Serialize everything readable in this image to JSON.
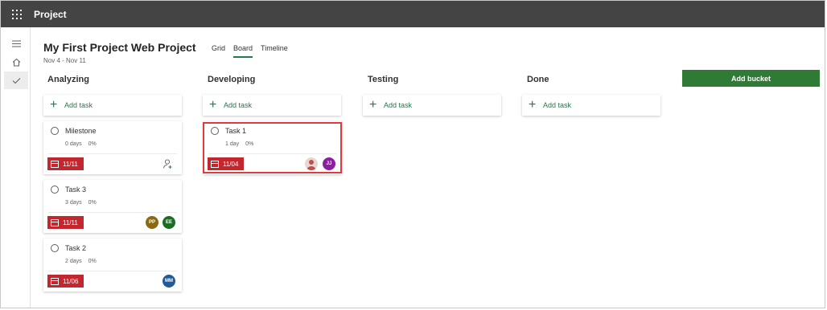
{
  "app": {
    "title": "Project"
  },
  "project": {
    "title": "My First Project Web Project",
    "dates": "Nov 4 - Nov 11"
  },
  "views": [
    {
      "label": "Grid",
      "active": false
    },
    {
      "label": "Board",
      "active": true
    },
    {
      "label": "Timeline",
      "active": false
    }
  ],
  "add_task_label": "Add task",
  "add_bucket_label": "Add bucket",
  "buckets": [
    {
      "title": "Analyzing",
      "tasks": [
        {
          "name": "Milestone",
          "duration": "0 days",
          "progress": "0%",
          "due": "11/11",
          "assignees": []
        },
        {
          "name": "Task 3",
          "duration": "3 days",
          "progress": "0%",
          "due": "11/11",
          "assignees": [
            "PP",
            "EE"
          ]
        },
        {
          "name": "Task 2",
          "duration": "2 days",
          "progress": "0%",
          "due": "11/06",
          "assignees": [
            "MM"
          ]
        }
      ]
    },
    {
      "title": "Developing",
      "tasks": [
        {
          "name": "Task 1",
          "duration": "1 day",
          "progress": "0%",
          "due": "11/04",
          "assignees": [
            "",
            "JJ"
          ]
        }
      ]
    },
    {
      "title": "Testing",
      "tasks": []
    },
    {
      "title": "Done",
      "tasks": []
    }
  ],
  "colors": {
    "accent": "#237b4b",
    "due_badge": "#c4262e",
    "avatar_PP": "#8a6a0e",
    "avatar_EE": "#1e6b24",
    "avatar_MM": "#1f5b9a",
    "avatar_JJ": "#8e1fa0",
    "avatar_photo": "#c0504d"
  },
  "icons": {
    "waffle": "app-launcher-icon",
    "rail_menu": "hamburger-icon",
    "rail_home": "home-icon",
    "rail_check": "checkmark-icon",
    "assign": "assign-person-icon",
    "calendar": "calendar-icon",
    "plus": "plus-icon"
  }
}
